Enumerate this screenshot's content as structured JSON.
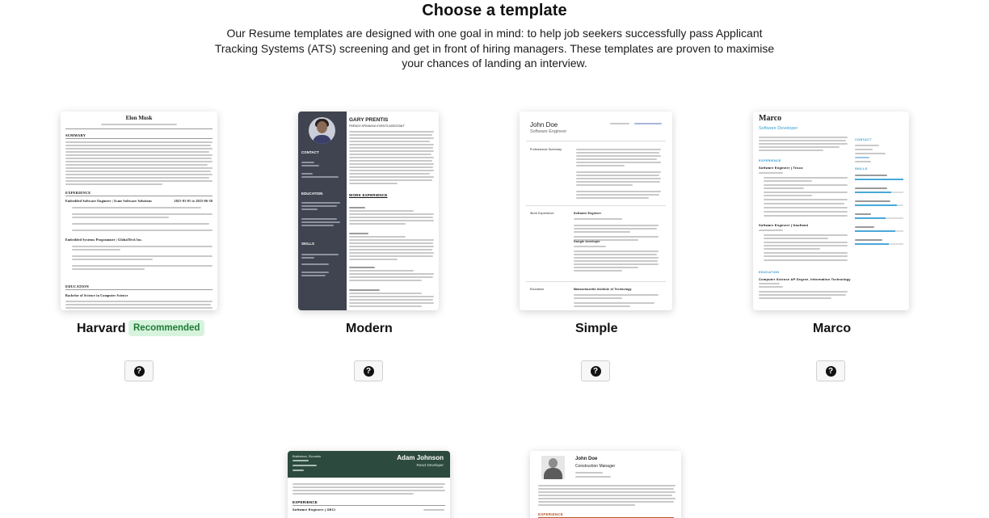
{
  "page": {
    "title": "Choose a template",
    "intro": "Our Resume templates are designed with one goal in mind: to help job seekers successfully pass Applicant Tracking Systems (ATS) screening and get in front of hiring managers. These templates are proven to maximise your chances of landing an interview."
  },
  "templates": [
    {
      "name": "Harvard",
      "badge": "Recommended",
      "preview": {
        "name": "Elon Musk",
        "sections": [
          "SUMMARY",
          "EXPERIENCE",
          "EDUCATION"
        ],
        "job1": "Embedded Software Engineer | Acme Software Solutions",
        "job1_dates": "2021-01-01 to 2023-06-30",
        "job2": "Embedded Systems Programmer | GlobalTech Inc.",
        "edu": "Bachelor of Science in Computer Science"
      }
    },
    {
      "name": "Modern",
      "preview": {
        "name": "GARY PRENTIS",
        "subtitle": "FRENCH SPEAKING EVENTS ASSISTANT",
        "side_sections": [
          "CONTACT",
          "EDUCATION",
          "SKILLS"
        ],
        "main_section": "WORK EXPERIENCE"
      }
    },
    {
      "name": "Simple",
      "preview": {
        "name": "John Doe",
        "role": "Software Engineer",
        "labels": [
          "Professional Summary",
          "Work Experience",
          "Education"
        ],
        "job1": "Software Engineer",
        "job2": "Google developer",
        "edu": "Massachusetts Institute of Technology"
      }
    },
    {
      "name": "Marco",
      "preview": {
        "name": "Marco",
        "role": "Software Developer",
        "sections": [
          "EXPERIENCE",
          "EDUCATION"
        ],
        "side": [
          "CONTACT",
          "SKILLS"
        ],
        "job1": "Software Engineer | Tesco",
        "job2": "Software Engineer | Kaufland",
        "edu": "Computer Science AP Degree, Information Technology"
      }
    },
    {
      "name": "",
      "preview": {
        "name": "Adam Johnson",
        "role": "React Developer",
        "location": "Bratislava, Slovakia",
        "sections": [
          "EXPERIENCE"
        ],
        "job1": "Software Engineer | GECI"
      }
    },
    {
      "name": "",
      "preview": {
        "name": "John Doe",
        "role": "Construction Manager",
        "sections": [
          "EXPERIENCE"
        ]
      }
    }
  ],
  "help_button": {
    "icon": "question-circle-icon",
    "glyph": "?"
  }
}
